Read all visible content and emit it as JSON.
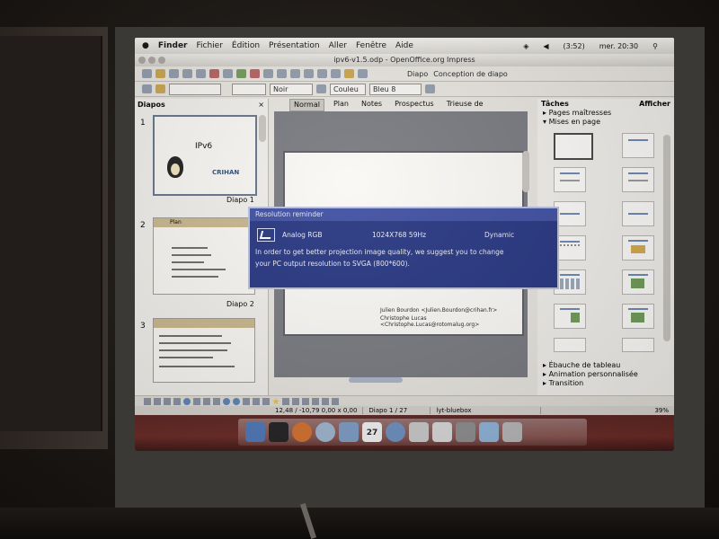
{
  "menubar": {
    "apple": "",
    "items": [
      "Finder",
      "Fichier",
      "Édition",
      "Présentation",
      "Aller",
      "Fenêtre",
      "Aide"
    ],
    "battery": "(3:52)",
    "clock": "mer. 20:30"
  },
  "window": {
    "title": "ipv6-v1.5.odp - OpenOffice.org Impress"
  },
  "toolbar": {
    "color_select": "Noir",
    "area_select": "Couleu",
    "color2_select": "Bleu 8",
    "diapo_label": "Diapo",
    "design_label": "Conception de diapo"
  },
  "slides_panel": {
    "title": "Diapos",
    "close": "×",
    "slides": [
      {
        "number": "1",
        "title": "IPv6",
        "logo": "CRIHAN",
        "label": "Diapo 1"
      },
      {
        "number": "2",
        "title": "Plan",
        "label": "Diapo 2"
      },
      {
        "number": "3",
        "title": "",
        "label": ""
      }
    ]
  },
  "view_tabs": [
    "Normal",
    "Plan",
    "Notes",
    "Prospectus",
    "Trieuse de diapositives"
  ],
  "main_slide": {
    "author1": "Julien Bourdon    <Julien.Bourdon@crihan.fr>",
    "author2": "Christophe Lucas <Christophe.Lucas@rotomalug.org>"
  },
  "tasks_panel": {
    "title": "Tâches",
    "view": "Afficher",
    "items": [
      "Pages maîtresses",
      "Mises en page"
    ],
    "bottom_items": [
      "Ébauche de tableau",
      "Animation personnalisée",
      "Transition"
    ]
  },
  "status_bar": {
    "position": "12,48 / -10,79  0,00 x 0,00",
    "slide": "Diapo 1 / 27",
    "layout": "lyt-bluebox",
    "zoom": "39%"
  },
  "popup": {
    "title": "Resolution reminder",
    "source": "Analog RGB",
    "resolution": "1024X768 59Hz",
    "mode": "Dynamic",
    "message_line1": "In order to get better projection image quality, we suggest you to change",
    "message_line2": "your PC output resolution to SVGA (800*600)."
  },
  "dock_calendar": "27",
  "colors": {
    "popup_bg": "#24337f",
    "popup_title_bg": "#3d4da0",
    "dock_bg": "#6b2a25"
  }
}
